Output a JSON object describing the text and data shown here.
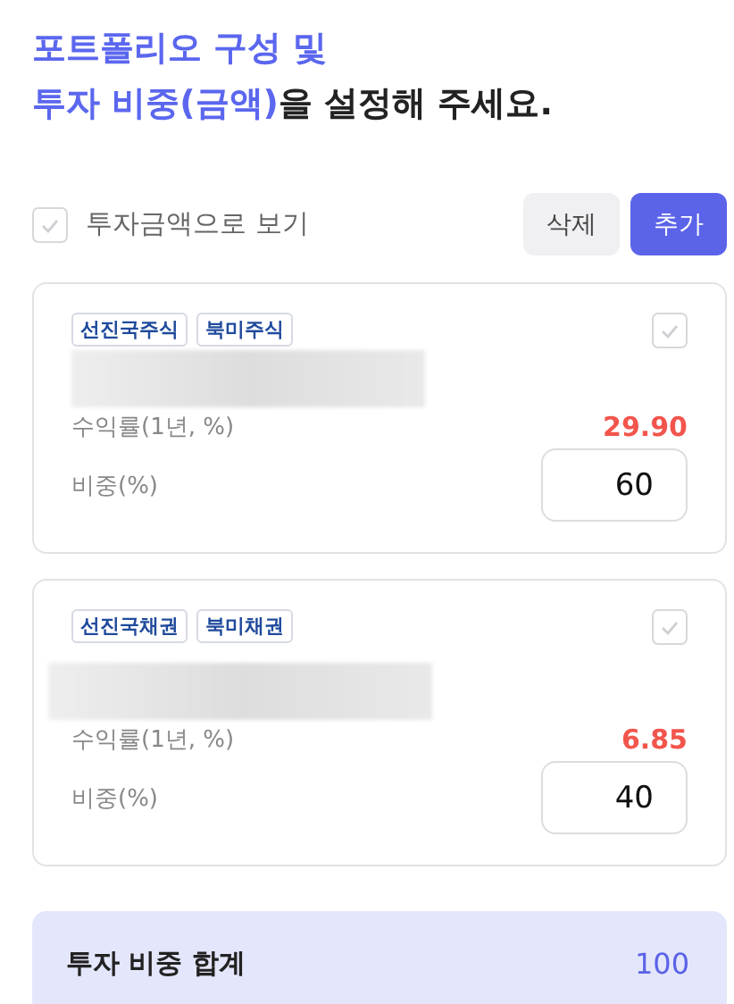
{
  "heading": {
    "lines": [
      [
        {
          "text": "포트폴리오 구성 및",
          "highlight": true
        }
      ],
      [
        {
          "text": "투자 비중(금액)",
          "highlight": true
        },
        {
          "text": "을 설정해 주세요.",
          "highlight": false
        }
      ]
    ]
  },
  "view_by_amount": {
    "label": "투자금액으로 보기",
    "checked": false
  },
  "buttons": [
    {
      "label": "삭제",
      "kind": "secondary"
    },
    {
      "label": "추가",
      "kind": "primary"
    }
  ],
  "holdings": [
    {
      "tags": [
        "선진국주식",
        "북미주식"
      ],
      "checked": false,
      "return_label": "수익률(1년, %)",
      "return_value": "29.90",
      "weight_label": "비중(%)",
      "weight": "60"
    },
    {
      "tags": [
        "선진국채권",
        "북미채권"
      ],
      "checked": false,
      "return_label": "수익률(1년, %)",
      "return_value": "6.85",
      "weight_label": "비중(%)",
      "weight": "40"
    }
  ],
  "total": {
    "label": "투자 비중 합계",
    "value": "100"
  }
}
